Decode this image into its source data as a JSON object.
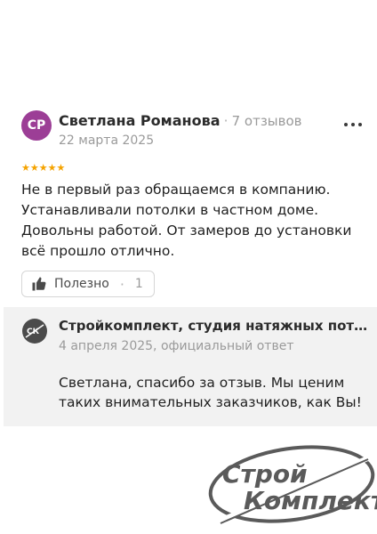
{
  "review": {
    "avatar_initials": "СР",
    "avatar_color": "#9c3e96",
    "author_name": "Светлана Романова",
    "reviews_count": "7 отзывов",
    "date": "22 марта 2025",
    "rating": 5,
    "stars": "★★★★★",
    "text": "Не в первый раз обращаемся в компанию. Устанавливали потолки в частном доме. Довольны работой. От замеров до установки всё прошло отлично.",
    "helpful_label": "Полезно",
    "helpful_count": "1",
    "more_icon": "more-horizontal-icon"
  },
  "reply": {
    "company_name": "Стройкомплект, студия натяжных потолков",
    "meta": "4 апреля 2025, официальный ответ",
    "text": "Светлана, спасибо за отзыв. Мы ценим таких внимательных заказчиков, как Вы!",
    "logo_icon": "company-logo-icon"
  },
  "watermark": {
    "line1": "Строй",
    "line2": "Комплект"
  },
  "colors": {
    "star": "#f5a300",
    "reply_background": "#f2f2f2",
    "muted_text": "#9a9a9a"
  }
}
